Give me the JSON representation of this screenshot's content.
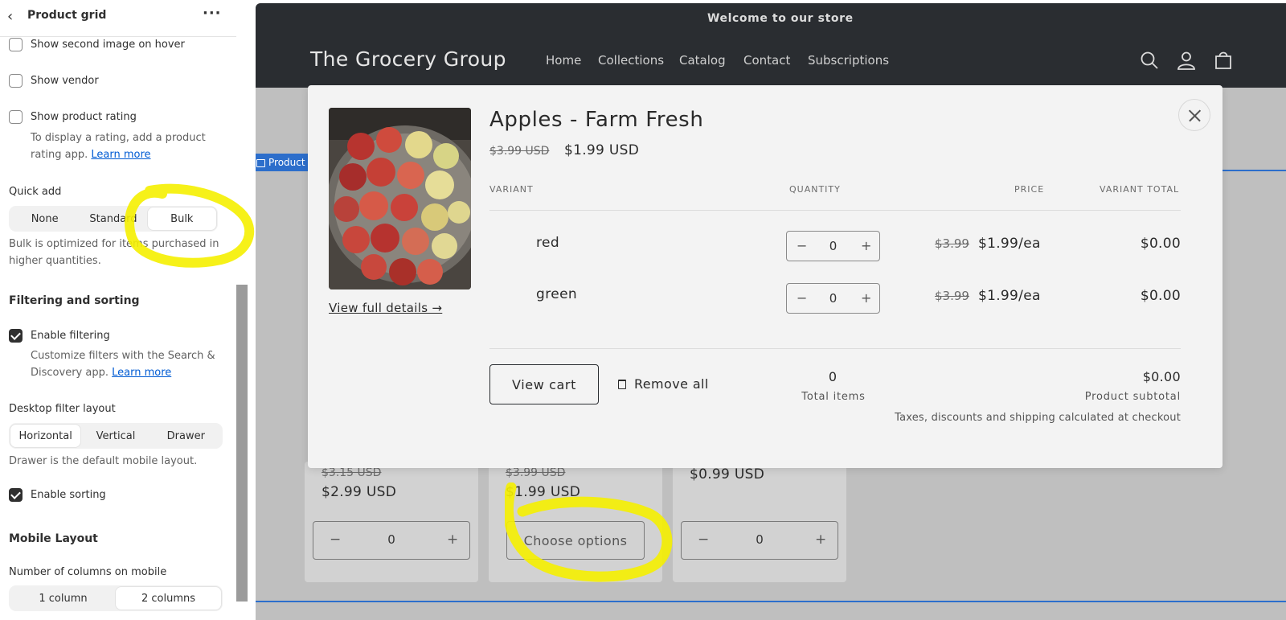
{
  "panel": {
    "title": "Product grid",
    "options": [
      {
        "label": "Show second image on hover",
        "checked": false
      },
      {
        "label": "Show vendor",
        "checked": false
      },
      {
        "label": "Show product rating",
        "checked": false
      }
    ],
    "rating_help": "To display a rating, add a product rating app.",
    "rating_help_link": "Learn more",
    "quick_add": {
      "label": "Quick add",
      "options": [
        "None",
        "Standard",
        "Bulk"
      ],
      "selected": "Bulk",
      "desc": "Bulk is optimized for items purchased in higher quantities."
    },
    "filtering": {
      "heading": "Filtering and sorting",
      "enable_filtering": "Enable filtering",
      "filtering_checked": true,
      "filter_help": "Customize filters with the Search & Discovery app.",
      "filter_help_link": "Learn more",
      "layout_label": "Desktop filter layout",
      "layout_options": [
        "Horizontal",
        "Vertical",
        "Drawer"
      ],
      "layout_selected": "Horizontal",
      "layout_desc": "Drawer is the default mobile layout.",
      "enable_sorting": "Enable sorting",
      "sorting_checked": true
    },
    "mobile": {
      "heading": "Mobile Layout",
      "columns_label": "Number of columns on mobile",
      "columns_options": [
        "1 column",
        "2 columns"
      ],
      "columns_selected": "2 columns"
    }
  },
  "store": {
    "announcement": "Welcome to our store",
    "logo": "The Grocery Group",
    "nav": [
      "Home",
      "Collections",
      "Catalog",
      "Contact",
      "Subscriptions"
    ],
    "section_tag": "Product grid",
    "accent_color": "#2c6ecb",
    "cards": [
      {
        "was": "$3.15 USD",
        "now": "$2.99 USD",
        "qty": "0"
      },
      {
        "was": "$3.99 USD",
        "now": "$1.99 USD",
        "button": "Choose options"
      },
      {
        "was": "",
        "now": "$0.99 USD",
        "qty": "0"
      }
    ]
  },
  "modal": {
    "title": "Apples - Farm Fresh",
    "price_was": "$3.99 USD",
    "price_now": "$1.99 USD",
    "view_full_details": "View full details →",
    "columns": {
      "variant": "VARIANT",
      "quantity": "QUANTITY",
      "price": "PRICE",
      "total": "VARIANT TOTAL"
    },
    "variants": [
      {
        "name": "red",
        "qty": "0",
        "was": "$3.99",
        "now": "$1.99/ea",
        "total": "$0.00"
      },
      {
        "name": "green",
        "qty": "0",
        "was": "$3.99",
        "now": "$1.99/ea",
        "total": "$0.00"
      }
    ],
    "view_cart": "View cart",
    "remove_all": "Remove all",
    "total_items_value": "0",
    "total_items_label": "Total items",
    "subtotal_value": "$0.00",
    "subtotal_label": "Product subtotal",
    "tax_note": "Taxes, discounts and shipping calculated at checkout"
  },
  "annotation_color": "#f5f000"
}
